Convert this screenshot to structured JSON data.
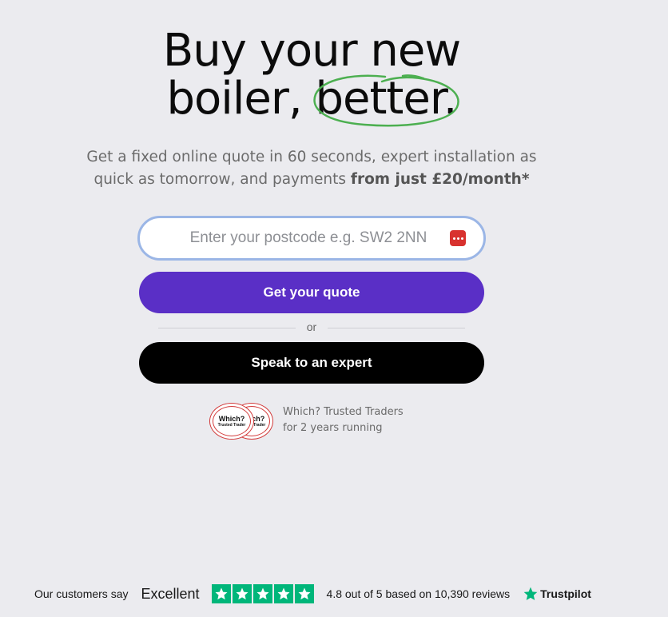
{
  "hero": {
    "title_line1": "Buy your new",
    "title_line2_prefix": "boiler, ",
    "title_line2_highlight": "better.",
    "subtitle_plain": "Get a fixed online quote in 60 seconds, expert installation as quick as tomorrow, and payments ",
    "subtitle_strong": "from just £20/month*"
  },
  "postcode": {
    "placeholder": "Enter your postcode e.g. SW2 2NN",
    "value": ""
  },
  "actions": {
    "quote_label": "Get your quote",
    "divider_label": "or",
    "expert_label": "Speak to an expert"
  },
  "which": {
    "badge_title": "Which?",
    "badge_sub": "Trusted Trader",
    "line1": "Which? Trusted Traders",
    "line2": "for 2 years running"
  },
  "trustpilot": {
    "lead": "Our customers say",
    "rating_word": "Excellent",
    "stars": 5,
    "summary": "4.8 out of 5 based on 10,390 reviews",
    "brand": "Trustpilot"
  },
  "colors": {
    "background": "#ebebef",
    "primary": "#5a2fc6",
    "expert": "#000000",
    "highlight_circle": "#4caf50",
    "input_border": "#9bb6e6",
    "trustpilot_green": "#00b67a",
    "password_manager_icon": "#d8322f"
  },
  "icons": {
    "password_manager": "password-manager-icon",
    "star": "star-icon",
    "trustpilot_logo": "trustpilot-star-icon"
  }
}
